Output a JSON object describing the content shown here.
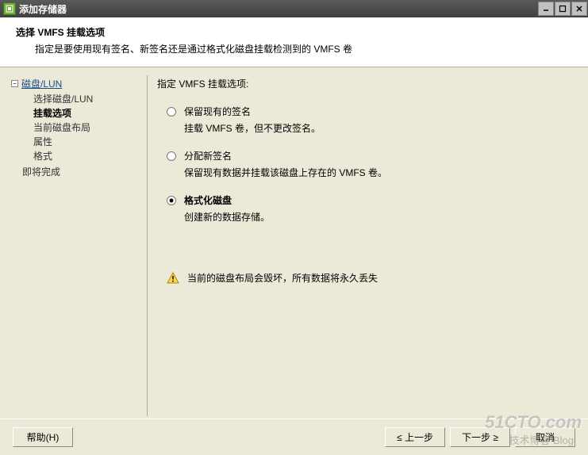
{
  "window": {
    "title": "添加存储器"
  },
  "header": {
    "title": "选择 VMFS 挂载选项",
    "subtitle": "指定是要使用现有签名、新签名还是通过格式化磁盘挂载检测到的 VMFS 卷"
  },
  "nav": {
    "root": "磁盘/LUN",
    "items": [
      "选择磁盘/LUN",
      "挂载选项",
      "当前磁盘布局",
      "属性",
      "格式"
    ],
    "boldIndex": 1,
    "finish": "即将完成"
  },
  "content": {
    "heading": "指定 VMFS 挂载选项:",
    "options": [
      {
        "label": "保留现有的签名",
        "desc": "挂载 VMFS 卷，但不更改签名。",
        "selected": false
      },
      {
        "label": "分配新签名",
        "desc": "保留现有数据并挂载该磁盘上存在的 VMFS 卷。",
        "selected": false
      },
      {
        "label": "格式化磁盘",
        "desc": "创建新的数据存储。",
        "selected": true
      }
    ],
    "warning": "当前的磁盘布局会毁坏，所有数据将永久丢失"
  },
  "footer": {
    "help": "帮助(H)",
    "back": "≤ 上一步",
    "next": "下一步 ≥",
    "cancel": "取消"
  },
  "watermark": {
    "main": "51CTO.com",
    "sub": "技术博客 Blog"
  }
}
